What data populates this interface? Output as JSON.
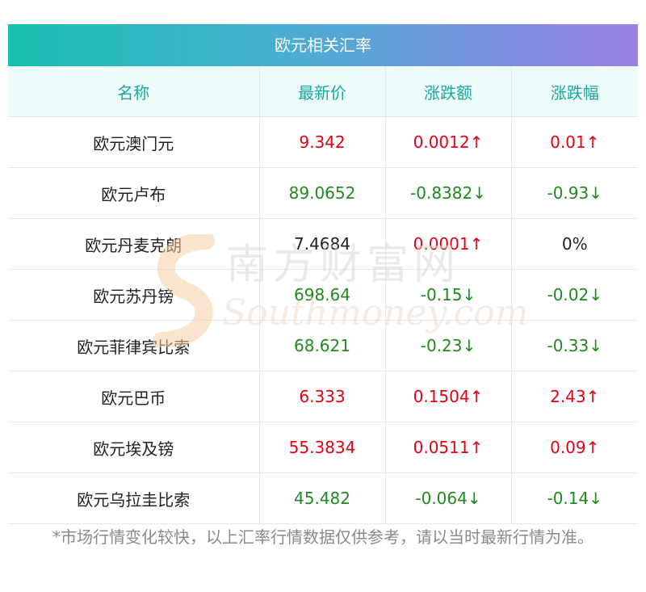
{
  "table": {
    "title": "欧元相关汇率",
    "headers": [
      "名称",
      "最新价",
      "涨跌额",
      "涨跌幅"
    ],
    "rows": [
      {
        "name": "欧元澳门元",
        "price": "9.342",
        "change": "0.0012↑",
        "pct": "0.01↑",
        "price_dir": "up",
        "change_dir": "up",
        "pct_dir": "up"
      },
      {
        "name": "欧元卢布",
        "price": "89.0652",
        "change": "-0.8382↓",
        "pct": "-0.93↓",
        "price_dir": "down",
        "change_dir": "down",
        "pct_dir": "down"
      },
      {
        "name": "欧元丹麦克朗",
        "price": "7.4684",
        "change": "0.0001↑",
        "pct": "0%",
        "price_dir": "flat",
        "change_dir": "up",
        "pct_dir": "flat"
      },
      {
        "name": "欧元苏丹镑",
        "price": "698.64",
        "change": "-0.15↓",
        "pct": "-0.02↓",
        "price_dir": "down",
        "change_dir": "down",
        "pct_dir": "down"
      },
      {
        "name": "欧元菲律宾比索",
        "price": "68.621",
        "change": "-0.23↓",
        "pct": "-0.33↓",
        "price_dir": "down",
        "change_dir": "down",
        "pct_dir": "down"
      },
      {
        "name": "欧元巴币",
        "price": "6.333",
        "change": "0.1504↑",
        "pct": "2.43↑",
        "price_dir": "up",
        "change_dir": "up",
        "pct_dir": "up"
      },
      {
        "name": "欧元埃及镑",
        "price": "55.3834",
        "change": "0.0511↑",
        "pct": "0.09↑",
        "price_dir": "up",
        "change_dir": "up",
        "pct_dir": "up"
      },
      {
        "name": "欧元乌拉圭比索",
        "price": "45.482",
        "change": "-0.064↓",
        "pct": "-0.14↓",
        "price_dir": "down",
        "change_dir": "down",
        "pct_dir": "down"
      }
    ]
  },
  "footnote": "*市场行情变化较快，以上汇率行情数据仅供参考，请以当时最新行情为准。",
  "watermark": {
    "cn": "南方财富网",
    "en": "Southmoney.com"
  },
  "colors": {
    "up": "#e60012",
    "down": "#1f8a1f",
    "header_text": "#18a89d"
  }
}
